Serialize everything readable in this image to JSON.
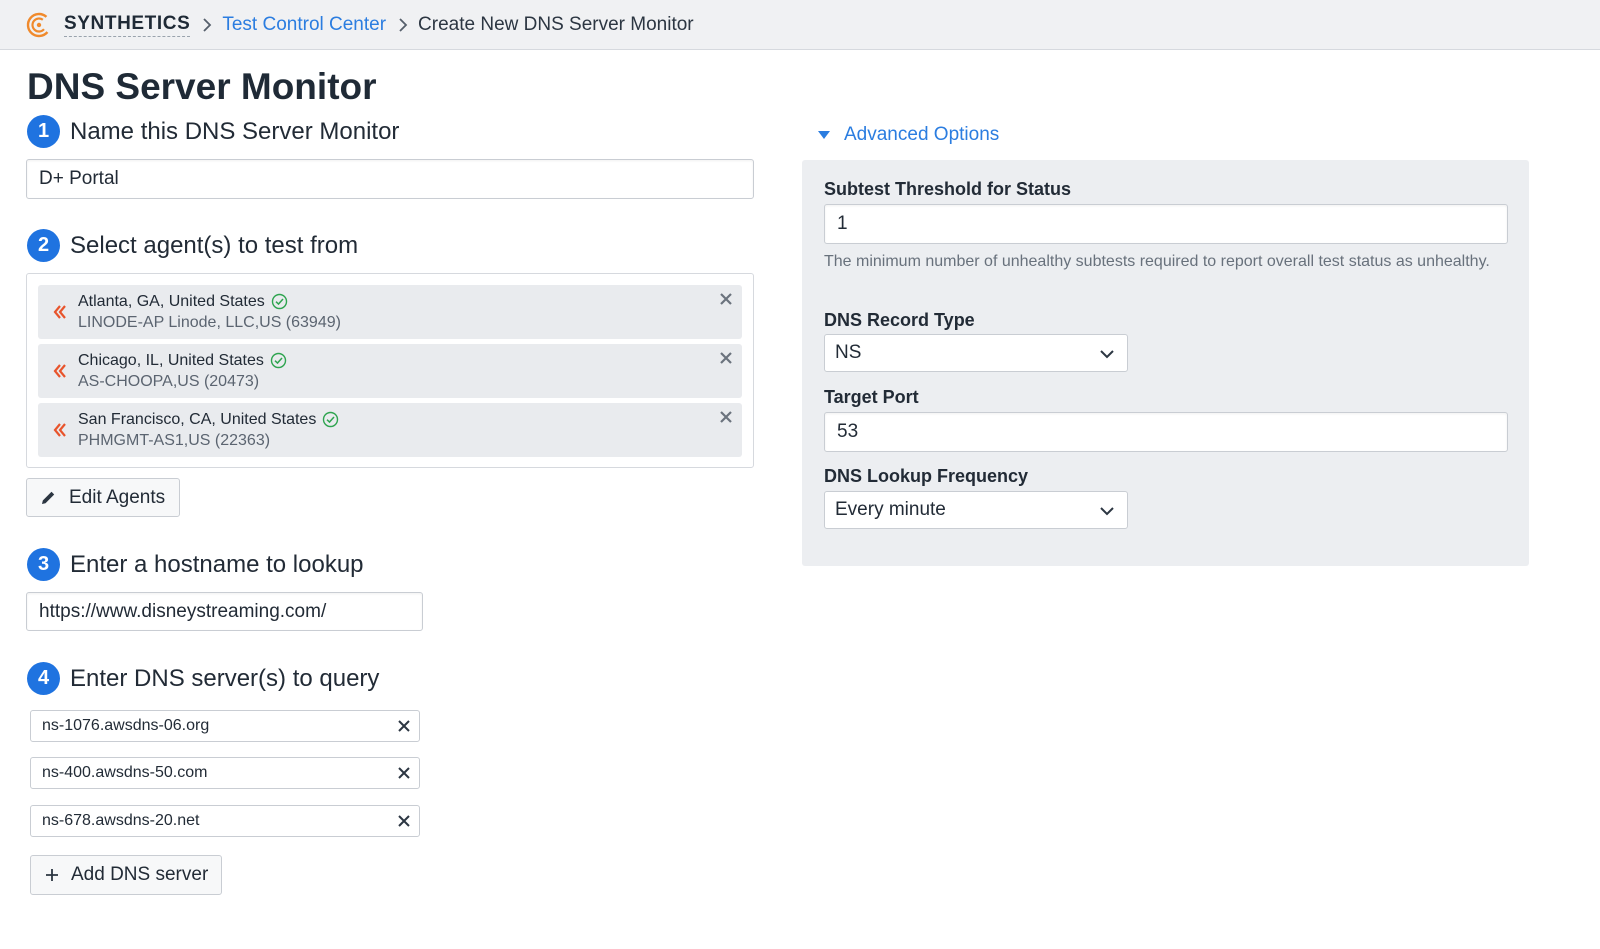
{
  "breadcrumb": {
    "brand": "SYNTHETICS",
    "link": "Test Control Center",
    "current": "Create New DNS Server Monitor"
  },
  "page_title": "DNS Server Monitor",
  "steps": [
    {
      "num": "1",
      "label": "Name this DNS Server Monitor"
    },
    {
      "num": "2",
      "label": "Select agent(s) to test from"
    },
    {
      "num": "3",
      "label": "Enter a hostname to lookup"
    },
    {
      "num": "4",
      "label": "Enter DNS server(s) to query"
    }
  ],
  "monitor_name": "D+ Portal",
  "agents": [
    {
      "location": "Atlanta, GA, United States",
      "network": "LINODE-AP Linode, LLC,US (63949)",
      "status": "healthy"
    },
    {
      "location": "Chicago, IL, United States",
      "network": "AS-CHOOPA,US (20473)",
      "status": "healthy"
    },
    {
      "location": "San Francisco, CA, United States",
      "network": "PHMGMT-AS1,US (22363)",
      "status": "healthy"
    }
  ],
  "edit_agents_label": "Edit Agents",
  "hostname": "https://www.disneystreaming.com/",
  "dns_servers": [
    "ns-1076.awsdns-06.org",
    "ns-400.awsdns-50.com",
    "ns-678.awsdns-20.net"
  ],
  "add_dns_label": "Add DNS server",
  "advanced": {
    "toggle_label": "Advanced Options",
    "subtest_threshold_label": "Subtest Threshold for Status",
    "subtest_threshold_value": "1",
    "subtest_help": "The minimum number of unhealthy subtests required to report overall test status as unhealthy.",
    "record_type_label": "DNS Record Type",
    "record_type_value": "NS",
    "target_port_label": "Target Port",
    "target_port_value": "53",
    "lookup_frequency_label": "DNS Lookup Frequency",
    "lookup_frequency_value": "Every minute"
  },
  "colors": {
    "accent": "#1f73e0",
    "link": "#2b7de0",
    "agent_icon": "#e8542c",
    "healthy": "#2ea44f"
  }
}
